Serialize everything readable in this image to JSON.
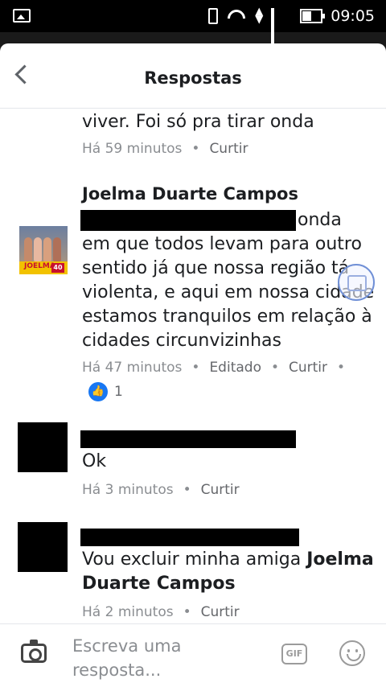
{
  "status_bar": {
    "time": "09:05"
  },
  "header": {
    "title": "Respostas"
  },
  "comments": [
    {
      "text_lines": [
        "viver. Foi só pra tirar onda"
      ],
      "time": "Há 59 minutos",
      "actions": [
        "Curtir"
      ]
    },
    {
      "author": "Joelma Duarte Campos",
      "avatar_text": "JOELMA",
      "avatar_badge": "40",
      "text_lines": [
        "onda",
        "em que todos levam para outro",
        "sentido já que nossa região tá",
        "violenta, e aqui em nossa cidade",
        "estamos tranquilos em relação à",
        "cidades circunvizinhas"
      ],
      "time": "Há 47 minutos",
      "actions": [
        "Editado",
        "Curtir"
      ],
      "likes": "1"
    },
    {
      "text_lines": [
        "Ok"
      ],
      "time": "Há 3 minutos",
      "actions": [
        "Curtir"
      ]
    },
    {
      "text_prefix": "Vou excluir minha amiga ",
      "mention_line1": "Joelma",
      "mention_line2": "Duarte Campos",
      "time": "Há 2 minutos",
      "actions": [
        "Curtir"
      ]
    }
  ],
  "composer": {
    "placeholder": "Escreva uma\nresposta...",
    "gif_label": "GIF"
  },
  "separator": "•",
  "colors": {
    "like_blue": "#1877f2",
    "meta_gray": "#8a8d91"
  }
}
